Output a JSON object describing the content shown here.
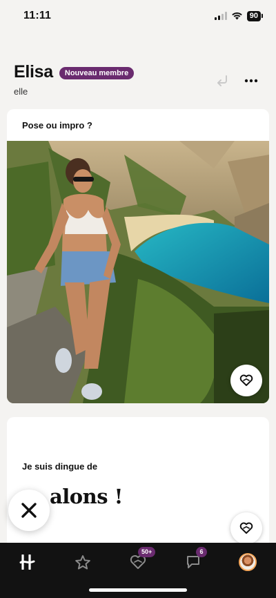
{
  "status_bar": {
    "time": "11:11",
    "battery": "90"
  },
  "profile": {
    "name": "Elisa",
    "badge": "Nouveau membre",
    "pronoun": "elle"
  },
  "photo_card": {
    "prompt": "Pose ou impro ?"
  },
  "prompt_card": {
    "question": "Je suis dingue de",
    "answer": "alons !"
  },
  "tab_bar": {
    "items": [
      {
        "name": "home",
        "icon": "hinge-logo-icon"
      },
      {
        "name": "standouts",
        "icon": "star-icon"
      },
      {
        "name": "likes",
        "icon": "heart-icon",
        "badge": "50+"
      },
      {
        "name": "messages",
        "icon": "chat-icon",
        "badge": "6"
      },
      {
        "name": "profile",
        "icon": "avatar"
      }
    ]
  },
  "colors": {
    "badge": "#6a2b6f",
    "tab_bar": "#121212",
    "background": "#f4f3f1"
  }
}
